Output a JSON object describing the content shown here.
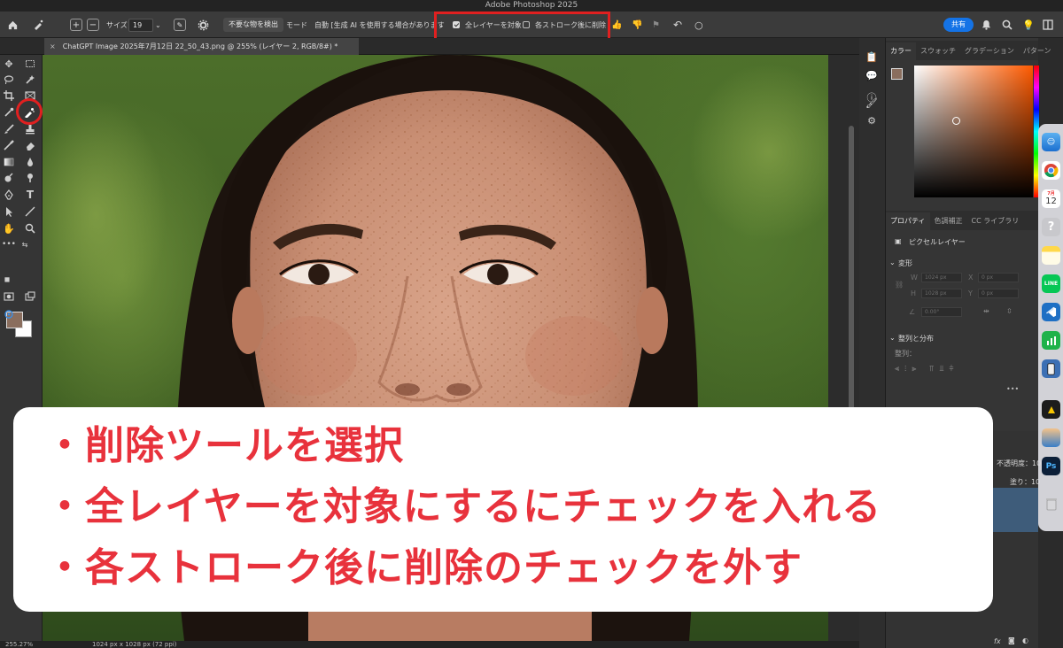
{
  "window": {
    "title": "Adobe Photoshop 2025"
  },
  "options_bar": {
    "size_label": "サイズ",
    "size_value": "19",
    "detect_button": "不要な物を検出",
    "mode_label": "モード",
    "mode_value": "自動 [生成 AI を使用する場合があります",
    "all_layers_label": "全レイヤーを対象",
    "all_layers_checked": true,
    "delete_after_stroke_label": "各ストローク後に削除",
    "delete_after_stroke_checked": false,
    "share_button": "共有"
  },
  "document_tab": {
    "title": "ChatGPT Image 2025年7月12日 22_50_43.png @ 255% (レイヤー 2, RGB/8#) *",
    "close_glyph": "×"
  },
  "status_bar": {
    "zoom": "255.27%",
    "doc_size": "1024 px x 1028 px (72 ppi)"
  },
  "panels": {
    "color_tabs": [
      "カラー",
      "スウォッチ",
      "グラデーション",
      "パターン"
    ],
    "props_tabs": [
      "プロパティ",
      "色調補正",
      "CC ライブラリ"
    ],
    "pixel_layer": "ピクセルレイヤー",
    "transform_section": "変形",
    "transform": {
      "w_label": "W",
      "w_value": "1024 px",
      "x_label": "X",
      "x_value": "0 px",
      "h_label": "H",
      "h_value": "1028 px",
      "y_label": "Y",
      "y_value": "0 px",
      "angle_value": "0.00°"
    },
    "align_section": "整列と分布",
    "align_label": "整列：",
    "more_dots": "•••",
    "opacity_label": "不透明度：10",
    "fill_label": "塗り：10",
    "layer_icons": "fx"
  },
  "dock": {
    "calendar_month": "7月",
    "calendar_day": "12",
    "ps_label": "Ps"
  },
  "instructions": [
    "・削除ツールを選択",
    "・全レイヤーを対象にするにチェックを入れる",
    "・各ストローク後に削除のチェックを外す"
  ],
  "colors": {
    "annotation_red": "#e02020",
    "instruction_text": "#e8323c",
    "foreground_color": "#8a6e5e",
    "share_blue": "#1473e6"
  }
}
